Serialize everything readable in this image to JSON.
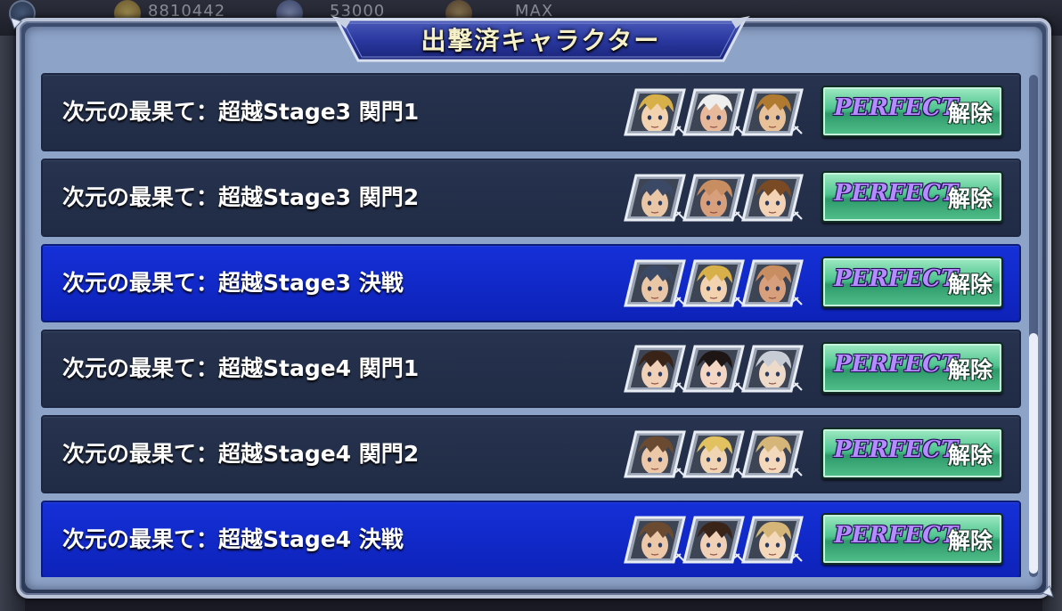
{
  "hud": {
    "gil": "8810442",
    "gems": "53000",
    "stamina": "MAX"
  },
  "panel": {
    "title": "出撃済キャラクター"
  },
  "rows": [
    {
      "label": "次元の最果て：超越Stage3 関門1",
      "highlight": false,
      "faces": [
        {
          "name": "blonde-warrior-face",
          "hair": "#d8b04a",
          "skin": "#f3d2b0"
        },
        {
          "name": "old-bearded-face",
          "hair": "#eeeeee",
          "skin": "#e8b89a"
        },
        {
          "name": "brown-spiky-face",
          "hair": "#b07a30",
          "skin": "#e8c198"
        }
      ],
      "button": {
        "perfect": "PERFECT",
        "unlock": "解除"
      }
    },
    {
      "label": "次元の最果て：超越Stage3 関門2",
      "highlight": false,
      "faces": [
        {
          "name": "capped-soldier-face",
          "hair": "#3b4866",
          "skin": "#e9c7a6"
        },
        {
          "name": "bald-mustache-face",
          "hair": "#c98d62",
          "skin": "#d89f7c"
        },
        {
          "name": "brown-haired-girl-face",
          "hair": "#7a4a24",
          "skin": "#f3d3b5"
        }
      ],
      "button": {
        "perfect": "PERFECT",
        "unlock": "解除"
      }
    },
    {
      "label": "次元の最果て：超越Stage3 決戦",
      "highlight": true,
      "faces": [
        {
          "name": "capped-soldier-face",
          "hair": "#3b4866",
          "skin": "#e9c7a6"
        },
        {
          "name": "blonde-warrior-face",
          "hair": "#d8b04a",
          "skin": "#f3d2b0"
        },
        {
          "name": "bald-mustache-face",
          "hair": "#c98d62",
          "skin": "#d89f7c"
        }
      ],
      "button": {
        "perfect": "PERFECT",
        "unlock": "解除"
      }
    },
    {
      "label": "次元の最果て：超越Stage4 関門1",
      "highlight": false,
      "faces": [
        {
          "name": "dark-haired-woman-face",
          "hair": "#3a2418",
          "skin": "#f0d0b6"
        },
        {
          "name": "black-haired-woman-face",
          "hair": "#1e1614",
          "skin": "#f3d6c4"
        },
        {
          "name": "silver-haired-face",
          "hair": "#c8ccd4",
          "skin": "#eedac8"
        }
      ],
      "button": {
        "perfect": "PERFECT",
        "unlock": "解除"
      }
    },
    {
      "label": "次元の最果て：超越Stage4 関門2",
      "highlight": false,
      "faces": [
        {
          "name": "brown-haired-man-face",
          "hair": "#6a4a30",
          "skin": "#ecc8a8"
        },
        {
          "name": "blonde-spiky-face",
          "hair": "#e2c260",
          "skin": "#f1d4b4"
        },
        {
          "name": "blonde-braid-face",
          "hair": "#d6b678",
          "skin": "#f4d8bc"
        }
      ],
      "button": {
        "perfect": "PERFECT",
        "unlock": "解除"
      }
    },
    {
      "label": "次元の最果て：超越Stage4 決戦",
      "highlight": true,
      "faces": [
        {
          "name": "brown-haired-man-face",
          "hair": "#6a4a30",
          "skin": "#ecc8a8"
        },
        {
          "name": "dark-haired-woman-face",
          "hair": "#3a2418",
          "skin": "#f0d0b6"
        },
        {
          "name": "blonde-braid-face",
          "hair": "#d6b678",
          "skin": "#f4d8bc"
        }
      ],
      "button": {
        "perfect": "PERFECT",
        "unlock": "解除"
      }
    }
  ],
  "colors": {
    "row": "#232f4b",
    "row_highlight": "#1128c8",
    "button": "#4fc590",
    "perfect_text": "#b58cff"
  }
}
